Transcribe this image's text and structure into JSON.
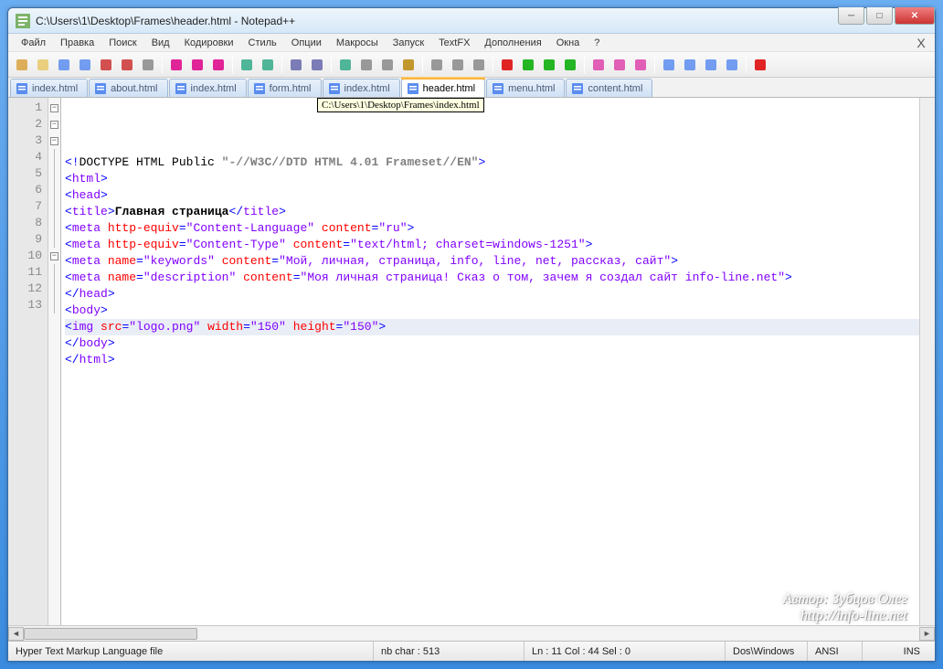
{
  "window": {
    "title": "C:\\Users\\1\\Desktop\\Frames\\header.html - Notepad++"
  },
  "menu": {
    "items": [
      "Файл",
      "Правка",
      "Поиск",
      "Вид",
      "Кодировки",
      "Стиль",
      "Опции",
      "Макросы",
      "Запуск",
      "TextFX",
      "Дополнения",
      "Окна",
      "?"
    ]
  },
  "tabs": {
    "items": [
      {
        "label": "index.html",
        "active": false
      },
      {
        "label": "about.html",
        "active": false
      },
      {
        "label": "index.html",
        "active": false
      },
      {
        "label": "form.html",
        "active": false
      },
      {
        "label": "index.html",
        "active": false
      },
      {
        "label": "header.html",
        "active": true
      },
      {
        "label": "menu.html",
        "active": false
      },
      {
        "label": "content.html",
        "active": false
      }
    ]
  },
  "tooltip": {
    "text": "C:\\Users\\1\\Desktop\\Frames\\index.html"
  },
  "codeLines": [
    {
      "n": 1,
      "fold": "open",
      "segments": [
        {
          "c": "tagp",
          "t": "<!"
        },
        {
          "c": "doct",
          "t": "DOCTYPE HTML Public "
        },
        {
          "c": "grayq",
          "t": "\"-//W3C//DTD HTML 4.01 Frameset//EN\""
        },
        {
          "c": "tagp",
          "t": ">"
        }
      ]
    },
    {
      "n": 2,
      "fold": "open",
      "segments": [
        {
          "c": "tagp",
          "t": "<"
        },
        {
          "c": "tagn",
          "t": "html"
        },
        {
          "c": "tagp",
          "t": ">"
        }
      ]
    },
    {
      "n": 3,
      "fold": "open",
      "segments": [
        {
          "c": "tagp",
          "t": "<"
        },
        {
          "c": "tagn",
          "t": "head"
        },
        {
          "c": "tagp",
          "t": ">"
        }
      ]
    },
    {
      "n": 4,
      "fold": "",
      "segments": [
        {
          "c": "tagp",
          "t": "<"
        },
        {
          "c": "tagn",
          "t": "title"
        },
        {
          "c": "tagp",
          "t": ">"
        },
        {
          "c": "txt",
          "t": "Главная страница"
        },
        {
          "c": "tagp",
          "t": "</"
        },
        {
          "c": "tagn",
          "t": "title"
        },
        {
          "c": "tagp",
          "t": ">"
        }
      ]
    },
    {
      "n": 5,
      "fold": "",
      "segments": [
        {
          "c": "tagp",
          "t": "<"
        },
        {
          "c": "tagn",
          "t": "meta "
        },
        {
          "c": "aname",
          "t": "http-equiv"
        },
        {
          "c": "tagp",
          "t": "="
        },
        {
          "c": "aval",
          "t": "\"Content-Language\""
        },
        {
          "c": "tagn",
          "t": " "
        },
        {
          "c": "aname",
          "t": "content"
        },
        {
          "c": "tagp",
          "t": "="
        },
        {
          "c": "aval",
          "t": "\"ru\""
        },
        {
          "c": "tagp",
          "t": ">"
        }
      ]
    },
    {
      "n": 6,
      "fold": "",
      "segments": [
        {
          "c": "tagp",
          "t": "<"
        },
        {
          "c": "tagn",
          "t": "meta "
        },
        {
          "c": "aname",
          "t": "http-equiv"
        },
        {
          "c": "tagp",
          "t": "="
        },
        {
          "c": "aval",
          "t": "\"Content-Type\""
        },
        {
          "c": "tagn",
          "t": " "
        },
        {
          "c": "aname",
          "t": "content"
        },
        {
          "c": "tagp",
          "t": "="
        },
        {
          "c": "aval",
          "t": "\"text/html; charset=windows-1251\""
        },
        {
          "c": "tagp",
          "t": ">"
        }
      ]
    },
    {
      "n": 7,
      "fold": "",
      "segments": [
        {
          "c": "tagp",
          "t": "<"
        },
        {
          "c": "tagn",
          "t": "meta "
        },
        {
          "c": "aname",
          "t": "name"
        },
        {
          "c": "tagp",
          "t": "="
        },
        {
          "c": "aval",
          "t": "\"keywords\""
        },
        {
          "c": "tagn",
          "t": " "
        },
        {
          "c": "aname",
          "t": "content"
        },
        {
          "c": "tagp",
          "t": "="
        },
        {
          "c": "aval",
          "t": "\"Мой, личная, страница, info, line, net, рассказ, сайт\""
        },
        {
          "c": "tagp",
          "t": ">"
        }
      ]
    },
    {
      "n": 8,
      "fold": "",
      "segments": [
        {
          "c": "tagp",
          "t": "<"
        },
        {
          "c": "tagn",
          "t": "meta "
        },
        {
          "c": "aname",
          "t": "name"
        },
        {
          "c": "tagp",
          "t": "="
        },
        {
          "c": "aval",
          "t": "\"description\""
        },
        {
          "c": "tagn",
          "t": " "
        },
        {
          "c": "aname",
          "t": "content"
        },
        {
          "c": "tagp",
          "t": "="
        },
        {
          "c": "aval",
          "t": "\"Моя личная страница! Сказ о том, зачем я создал сайт info-line.net\""
        },
        {
          "c": "tagp",
          "t": ">"
        }
      ]
    },
    {
      "n": 9,
      "fold": "",
      "segments": [
        {
          "c": "tagp",
          "t": "</"
        },
        {
          "c": "tagn",
          "t": "head"
        },
        {
          "c": "tagp",
          "t": ">"
        }
      ]
    },
    {
      "n": 10,
      "fold": "open",
      "segments": [
        {
          "c": "tagp",
          "t": "<"
        },
        {
          "c": "tagn",
          "t": "body"
        },
        {
          "c": "tagp",
          "t": ">"
        }
      ]
    },
    {
      "n": 11,
      "fold": "",
      "hl": true,
      "segments": [
        {
          "c": "tagp",
          "t": "<"
        },
        {
          "c": "tagn",
          "t": "img "
        },
        {
          "c": "aname",
          "t": "src"
        },
        {
          "c": "tagp",
          "t": "="
        },
        {
          "c": "aval",
          "t": "\"logo.png\""
        },
        {
          "c": "tagn",
          "t": " "
        },
        {
          "c": "aname",
          "t": "width"
        },
        {
          "c": "tagp",
          "t": "="
        },
        {
          "c": "aval",
          "t": "\"150\""
        },
        {
          "c": "tagn",
          "t": " "
        },
        {
          "c": "aname",
          "t": "height"
        },
        {
          "c": "tagp",
          "t": "="
        },
        {
          "c": "aval",
          "t": "\"150\""
        },
        {
          "c": "tagp",
          "t": ">"
        }
      ]
    },
    {
      "n": 12,
      "fold": "",
      "segments": [
        {
          "c": "tagp",
          "t": "</"
        },
        {
          "c": "tagn",
          "t": "body"
        },
        {
          "c": "tagp",
          "t": ">"
        }
      ]
    },
    {
      "n": 13,
      "fold": "",
      "segments": [
        {
          "c": "tagp",
          "t": "</"
        },
        {
          "c": "tagn",
          "t": "html"
        },
        {
          "c": "tagp",
          "t": ">"
        }
      ]
    }
  ],
  "status": {
    "filetype": "Hyper Text Markup Language file",
    "nbchar": "nb char : 513",
    "pos": "Ln : 11    Col : 44    Sel : 0",
    "eol": "Dos\\Windows",
    "enc": "ANSI",
    "mode": "INS"
  },
  "watermark": {
    "line1": "Автор: Зубцов Олег",
    "line2": "http://info-line.net"
  },
  "toolbar_icons": [
    "new",
    "open",
    "save",
    "save-all",
    "close",
    "close-all",
    "print",
    "|",
    "cut",
    "copy",
    "paste",
    "|",
    "undo",
    "redo",
    "|",
    "find",
    "replace",
    "|",
    "ww",
    "guides",
    "indent",
    "ud1",
    "|",
    "fold",
    "unfold",
    "hide",
    "|",
    "rec",
    "play",
    "play4",
    "play1",
    "|",
    "run1",
    "run2",
    "run3",
    "|",
    "plug1",
    "plug2",
    "plug3",
    "plug4",
    "|",
    "spell"
  ]
}
